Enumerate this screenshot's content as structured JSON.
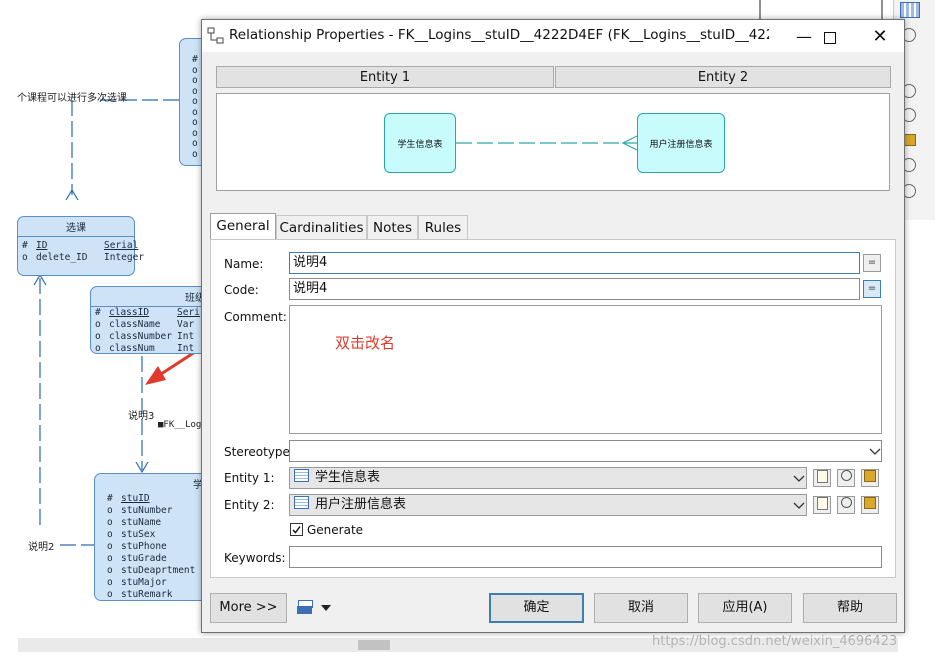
{
  "diagram": {
    "top_text": "个课程可以进行多次选课",
    "xuanke": {
      "title": "选课",
      "rows": [
        {
          "mark": "#",
          "name": "ID",
          "type": "Serial"
        },
        {
          "mark": "o",
          "name": "delete_ID",
          "type": "Integer"
        }
      ]
    },
    "banji": {
      "title": "班级",
      "rows": [
        {
          "mark": "#",
          "name": "classID",
          "type": "Seri"
        },
        {
          "mark": "o",
          "name": "className",
          "type": "Var"
        },
        {
          "mark": "o",
          "name": "classNumber",
          "type": "Int"
        },
        {
          "mark": "o",
          "name": "classNum",
          "type": "Int"
        }
      ]
    },
    "xuesheng": {
      "title": "学",
      "rows": [
        {
          "mark": "#",
          "name": "stuID"
        },
        {
          "mark": "o",
          "name": "stuNumber"
        },
        {
          "mark": "o",
          "name": "stuName"
        },
        {
          "mark": "o",
          "name": "stuSex"
        },
        {
          "mark": "o",
          "name": "stuPhone"
        },
        {
          "mark": "o",
          "name": "stuGrade"
        },
        {
          "mark": "o",
          "name": "stuDeaprtment"
        },
        {
          "mark": "o",
          "name": "stuMajor"
        },
        {
          "mark": "o",
          "name": "stuRemark"
        }
      ]
    },
    "top_entity_marks": [
      "#",
      "o",
      "o",
      "o",
      "o",
      "o",
      "o",
      "o",
      "o",
      "o"
    ],
    "label_shuoming3": "说明3",
    "label_fk": "■FK__Log",
    "label_shuoming2": "说明2"
  },
  "watermark": "https://blog.csdn.net/weixin_4696423",
  "dialog": {
    "title": "Relationship Properties - FK__Logins__stuID__4222D4EF (FK__Logins__stuID__4222...",
    "entity1_header": "Entity 1",
    "entity2_header": "Entity 2",
    "preview_entity1": "学生信息表",
    "preview_entity2": "用户注册信息表",
    "tabs": [
      "General",
      "Cardinalities",
      "Notes",
      "Rules"
    ],
    "labels": {
      "name": "Name:",
      "code": "Code:",
      "comment": "Comment:",
      "stereotype": "Stereotype:",
      "entity1": "Entity 1:",
      "entity2": "Entity 2:",
      "generate": "Generate",
      "keywords": "Keywords:"
    },
    "values": {
      "name": "说明4",
      "code": "说明4",
      "comment_annotation": "双击改名",
      "stereotype": "",
      "entity1": "学生信息表",
      "entity2": "用户注册信息表",
      "keywords": ""
    },
    "generate_checked": true,
    "buttons": {
      "more": "More >>",
      "ok": "确定",
      "cancel": "取消",
      "apply": "应用(A)",
      "help": "帮助"
    }
  }
}
